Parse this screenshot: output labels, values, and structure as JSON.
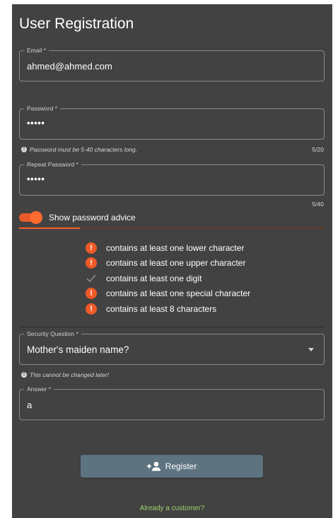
{
  "form": {
    "title": "User Registration",
    "email": {
      "label": "Email *",
      "value": "ahmed@ahmed.com"
    },
    "password": {
      "label": "Password *",
      "value": "•••••",
      "hint": "Password must be 5-40 characters long.",
      "counter": "5/20"
    },
    "repeat_password": {
      "label": "Repeat Password *",
      "value": "•••••",
      "counter": "5/40"
    },
    "advice_toggle": {
      "label": "Show password advice",
      "on": true,
      "strength_percent": 20
    },
    "advice": [
      {
        "text": "contains at least one lower character",
        "status": "error",
        "icon": "error-icon"
      },
      {
        "text": "contains at least one upper character",
        "status": "error",
        "icon": "error-icon"
      },
      {
        "text": "contains at least one digit",
        "status": "ok",
        "icon": "check-icon"
      },
      {
        "text": "contains at least one special character",
        "status": "error",
        "icon": "error-icon"
      },
      {
        "text": "contains at least 8 characters",
        "status": "error",
        "icon": "error-icon"
      }
    ],
    "security_question": {
      "label": "Security Question *",
      "value": "Mother's maiden name?",
      "hint": "This cannot be changed later!"
    },
    "answer": {
      "label": "Answer *",
      "value": "a"
    },
    "register_label": "Register",
    "login_link": "Already a customer?"
  },
  "colors": {
    "card_bg": "#424242",
    "accent": "#ff5f27",
    "button": "#5d7380",
    "link": "#9bd36a"
  }
}
